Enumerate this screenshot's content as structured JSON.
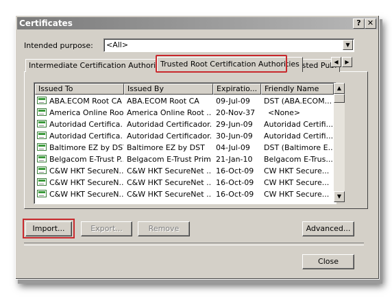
{
  "window": {
    "title": "Certificates",
    "help_label": "?",
    "close_label": "✕"
  },
  "purpose": {
    "label": "Intended purpose:",
    "value": "<All>",
    "arrow": "▼"
  },
  "tabs": {
    "items": [
      {
        "label": "Intermediate Certification Authorities"
      },
      {
        "label": "Trusted Root Certification Authorities"
      },
      {
        "label": "Trusted Publ"
      }
    ],
    "left_arrow": "◀",
    "right_arrow": "▶"
  },
  "list": {
    "columns": [
      "Issued To",
      "Issued By",
      "Expiratio...",
      "Friendly Name"
    ],
    "rows": [
      [
        "ABA.ECOM Root CA",
        "ABA.ECOM Root CA",
        "09-Jul-09",
        "DST (ABA.ECOM..."
      ],
      [
        "America Online Roo...",
        "America Online Root ...",
        "20-Nov-37",
        "<None>"
      ],
      [
        "Autoridad Certifica...",
        "Autoridad Certificador...",
        "29-Jun-09",
        "Autoridad Certifi..."
      ],
      [
        "Autoridad Certifica...",
        "Autoridad Certificador...",
        "30-Jun-09",
        "Autoridad Certifi..."
      ],
      [
        "Baltimore EZ by DST",
        "Baltimore EZ by DST",
        "04-Jul-09",
        "DST (Baltimore E..."
      ],
      [
        "Belgacom E-Trust P...",
        "Belgacom E-Trust Prim...",
        "21-Jan-10",
        "Belgacom E-Trus..."
      ],
      [
        "C&W HKT SecureN...",
        "C&W HKT SecureNet ...",
        "16-Oct-09",
        "CW HKT Secure..."
      ],
      [
        "C&W HKT SecureN...",
        "C&W HKT SecureNet ...",
        "16-Oct-09",
        "CW HKT Secure..."
      ],
      [
        "C&W HKT SecureN...",
        "C&W HKT SecureNet ...",
        "16-Oct-09",
        "CW HKT Secure..."
      ]
    ],
    "scroll_up": "▲",
    "scroll_down": "▼"
  },
  "buttons": {
    "import": "Import...",
    "export": "Export...",
    "remove": "Remove",
    "advanced": "Advanced...",
    "close": "Close"
  },
  "colors": {
    "dialog_bg": "#d4d0c8",
    "highlight": "#c8282c",
    "title_gradient_start": "#7a7a7a"
  }
}
